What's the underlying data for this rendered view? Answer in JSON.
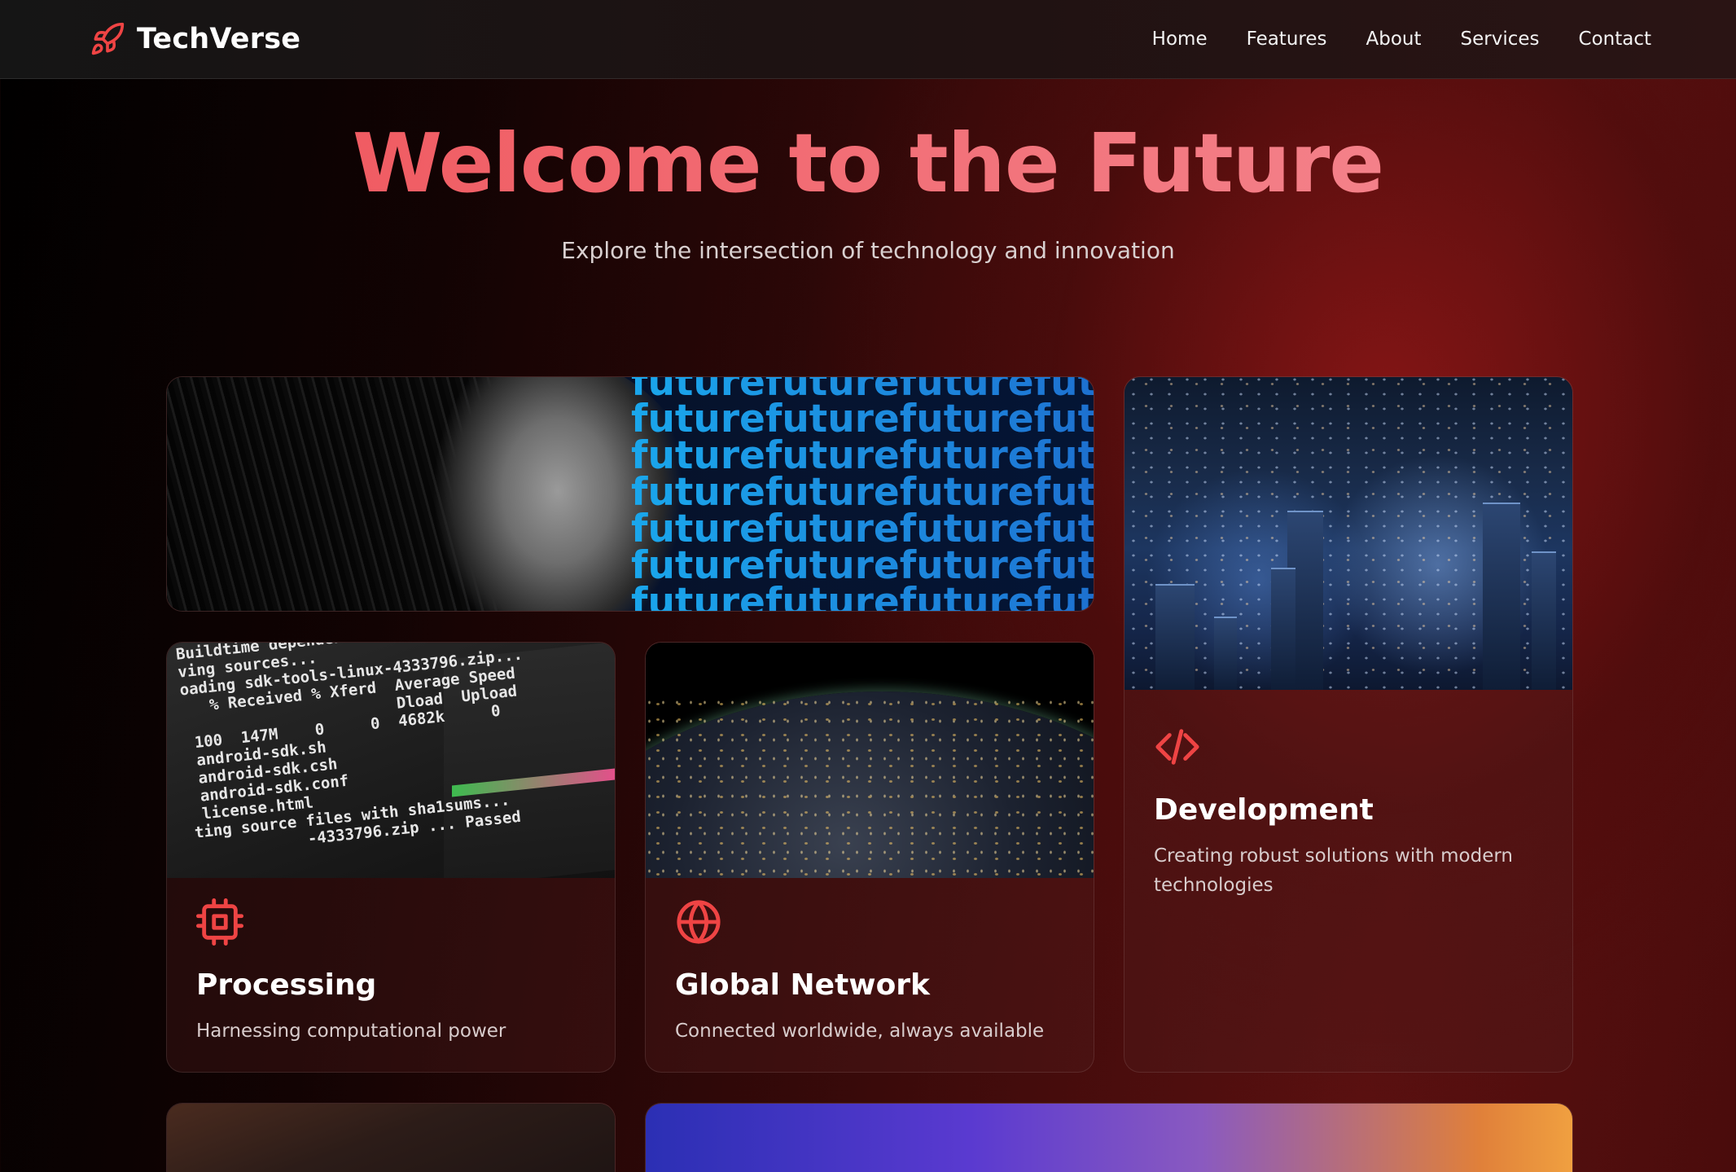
{
  "brand": {
    "name": "TechVerse",
    "icon": "rocket-icon",
    "accent": "#ef4444"
  },
  "nav": {
    "items": [
      "Home",
      "Features",
      "About",
      "Services",
      "Contact"
    ]
  },
  "hero": {
    "title": "Welcome to the Future",
    "subtitle": "Explore the intersection of technology and innovation",
    "title_gradient": [
      "#ef4f55",
      "#f58d96"
    ]
  },
  "cards": {
    "future": {
      "image": "woman-profile-future-text-image",
      "repeated_text": "futurefuturefuturefuturefuture"
    },
    "development": {
      "image": "city-night-aerial-image",
      "icon": "code-icon",
      "title": "Development",
      "description": "Creating robust solutions with modern technologies"
    },
    "processing": {
      "image": "terminal-screen-image",
      "icon": "cpu-icon",
      "title": "Processing",
      "description": "Harnessing computational power"
    },
    "network": {
      "image": "earth-night-lights-image",
      "icon": "globe-icon",
      "title": "Global Network",
      "description": "Connected worldwide, always available"
    }
  },
  "terminal_text": {
    "lines": [
      "Buildtime dependencies...",
      "ving sources...",
      "oading sdk-tools-linux-4333796.zip...",
      "   % Received % Xferd  Average Speed",
      "                       Dload  Upload",
      " 100  147M    0     0  4682k     0",
      " android-sdk.sh",
      " android-sdk.csh",
      " android-sdk.conf",
      " license.html",
      "ting source files with sha1sums...",
      "            -4333796.zip ... Passed"
    ]
  }
}
